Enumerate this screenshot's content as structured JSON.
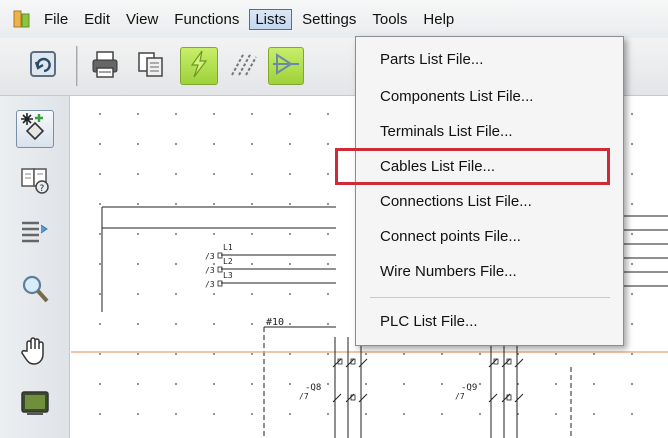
{
  "menubar": {
    "items": [
      "File",
      "Edit",
      "View",
      "Functions",
      "Lists",
      "Settings",
      "Tools",
      "Help"
    ],
    "active": "Lists"
  },
  "lists_menu": {
    "items": [
      "Parts List File...",
      "Components List File...",
      "Terminals List File...",
      "Cables List File...",
      "Connections List File...",
      "Connect points File...",
      "Wire Numbers File...",
      "PLC List File..."
    ],
    "highlighted": "Cables List File..."
  },
  "schematic": {
    "line_labels": [
      "L1",
      "L2",
      "L3"
    ],
    "ref_prefix": "/3",
    "marker": "#10",
    "device_label_left": "-Q8",
    "device_label_right": "-Q9",
    "device_prefix": "/7"
  },
  "colors": {
    "highlight_box": "#cf2a35",
    "toolbar_green": "#a6d640",
    "wire_orange": "#e8a070"
  },
  "icons": {
    "toolbar": [
      "rotate-icon",
      "print-icon",
      "copy-icon",
      "lightning-icon",
      "hatch-icon",
      "arrow-icon"
    ],
    "left": [
      "insert-component-icon",
      "book-help-icon",
      "list-arrow-icon",
      "zoom-icon",
      "pan-hand-icon",
      "screen-icon"
    ]
  }
}
